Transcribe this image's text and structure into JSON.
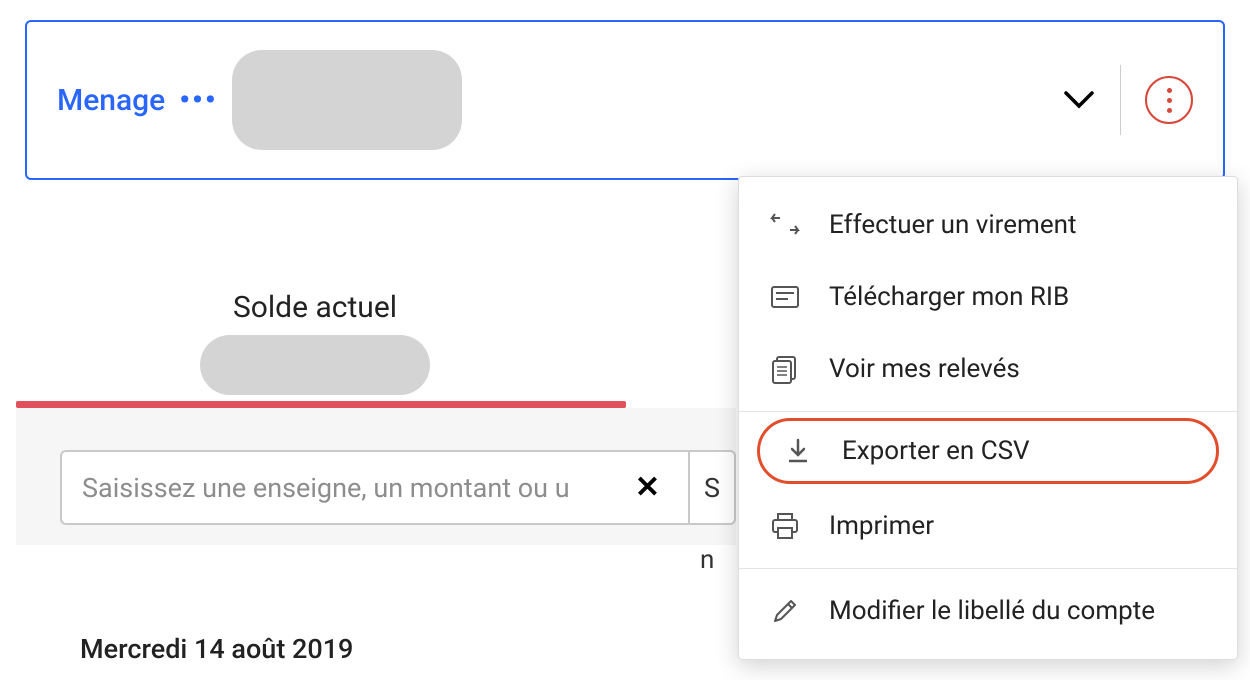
{
  "account": {
    "name": "Menage",
    "dots": "•••"
  },
  "balance": {
    "label": "Solde actuel"
  },
  "search": {
    "placeholder": "Saisissez une enseigne, un montant ou u",
    "filter_initial": "S",
    "partial_char": "n"
  },
  "date_header": "Mercredi 14 août 2019",
  "menu": {
    "items": [
      {
        "label": "Effectuer un virement",
        "icon": "transfer"
      },
      {
        "label": "Télécharger mon RIB",
        "icon": "rib"
      },
      {
        "label": "Voir mes relevés",
        "icon": "statements"
      },
      {
        "label": "Exporter en CSV",
        "icon": "download",
        "highlighted": true
      },
      {
        "label": "Imprimer",
        "icon": "print"
      },
      {
        "label": "Modifier le libellé du compte",
        "icon": "edit"
      }
    ]
  }
}
